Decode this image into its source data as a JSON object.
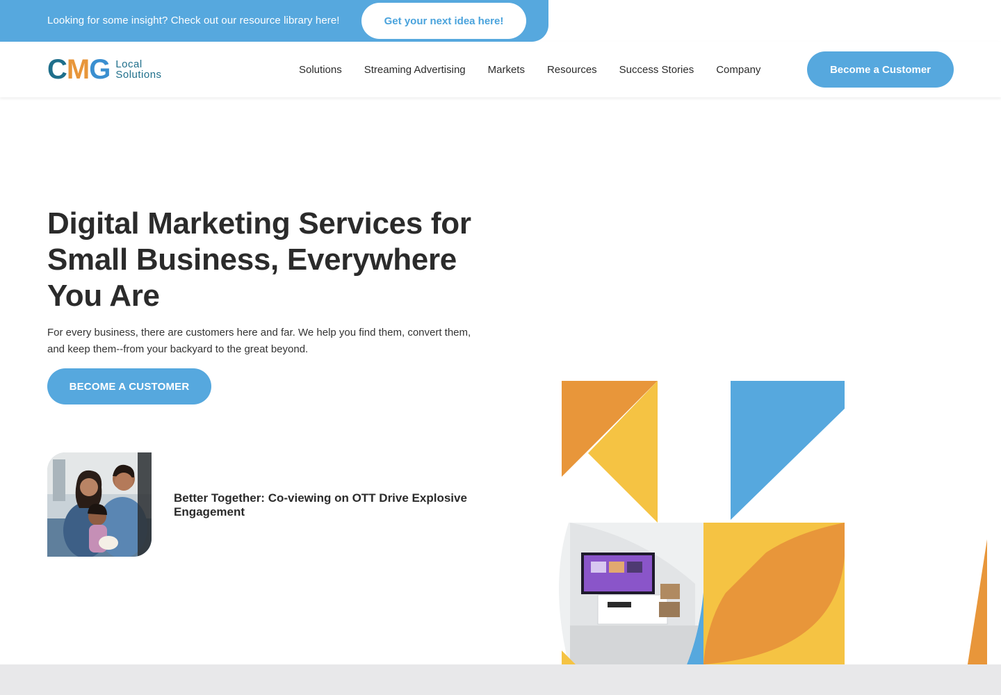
{
  "promo": {
    "text": "Looking for some insight? Check out our resource library here!",
    "button_label": "Get your next idea here!"
  },
  "header": {
    "logo_letters": [
      "C",
      "M",
      "G"
    ],
    "logo_sub_line1": "Local",
    "logo_sub_line2": "Solutions",
    "nav": [
      "Solutions",
      "Streaming Advertising",
      "Markets",
      "Resources",
      "Success Stories",
      "Company"
    ],
    "cta_label": "Become a Customer"
  },
  "hero": {
    "title": "Digital Marketing Services for Small Business, Everywhere You Are",
    "description": "For every business, there are customers here and far. We help you find them, convert them, and keep them--from your backyard to the great beyond.",
    "cta_label": "BECOME A CUSTOMER"
  },
  "featured_article": {
    "title": "Better Together: Co-viewing on OTT Drive Explosive Engagement"
  },
  "colors": {
    "brand_blue": "#56a8de",
    "brand_teal": "#1f6f8b",
    "orange": "#e8963a",
    "yellow": "#f5c343",
    "text_dark": "#2b2b2b"
  }
}
